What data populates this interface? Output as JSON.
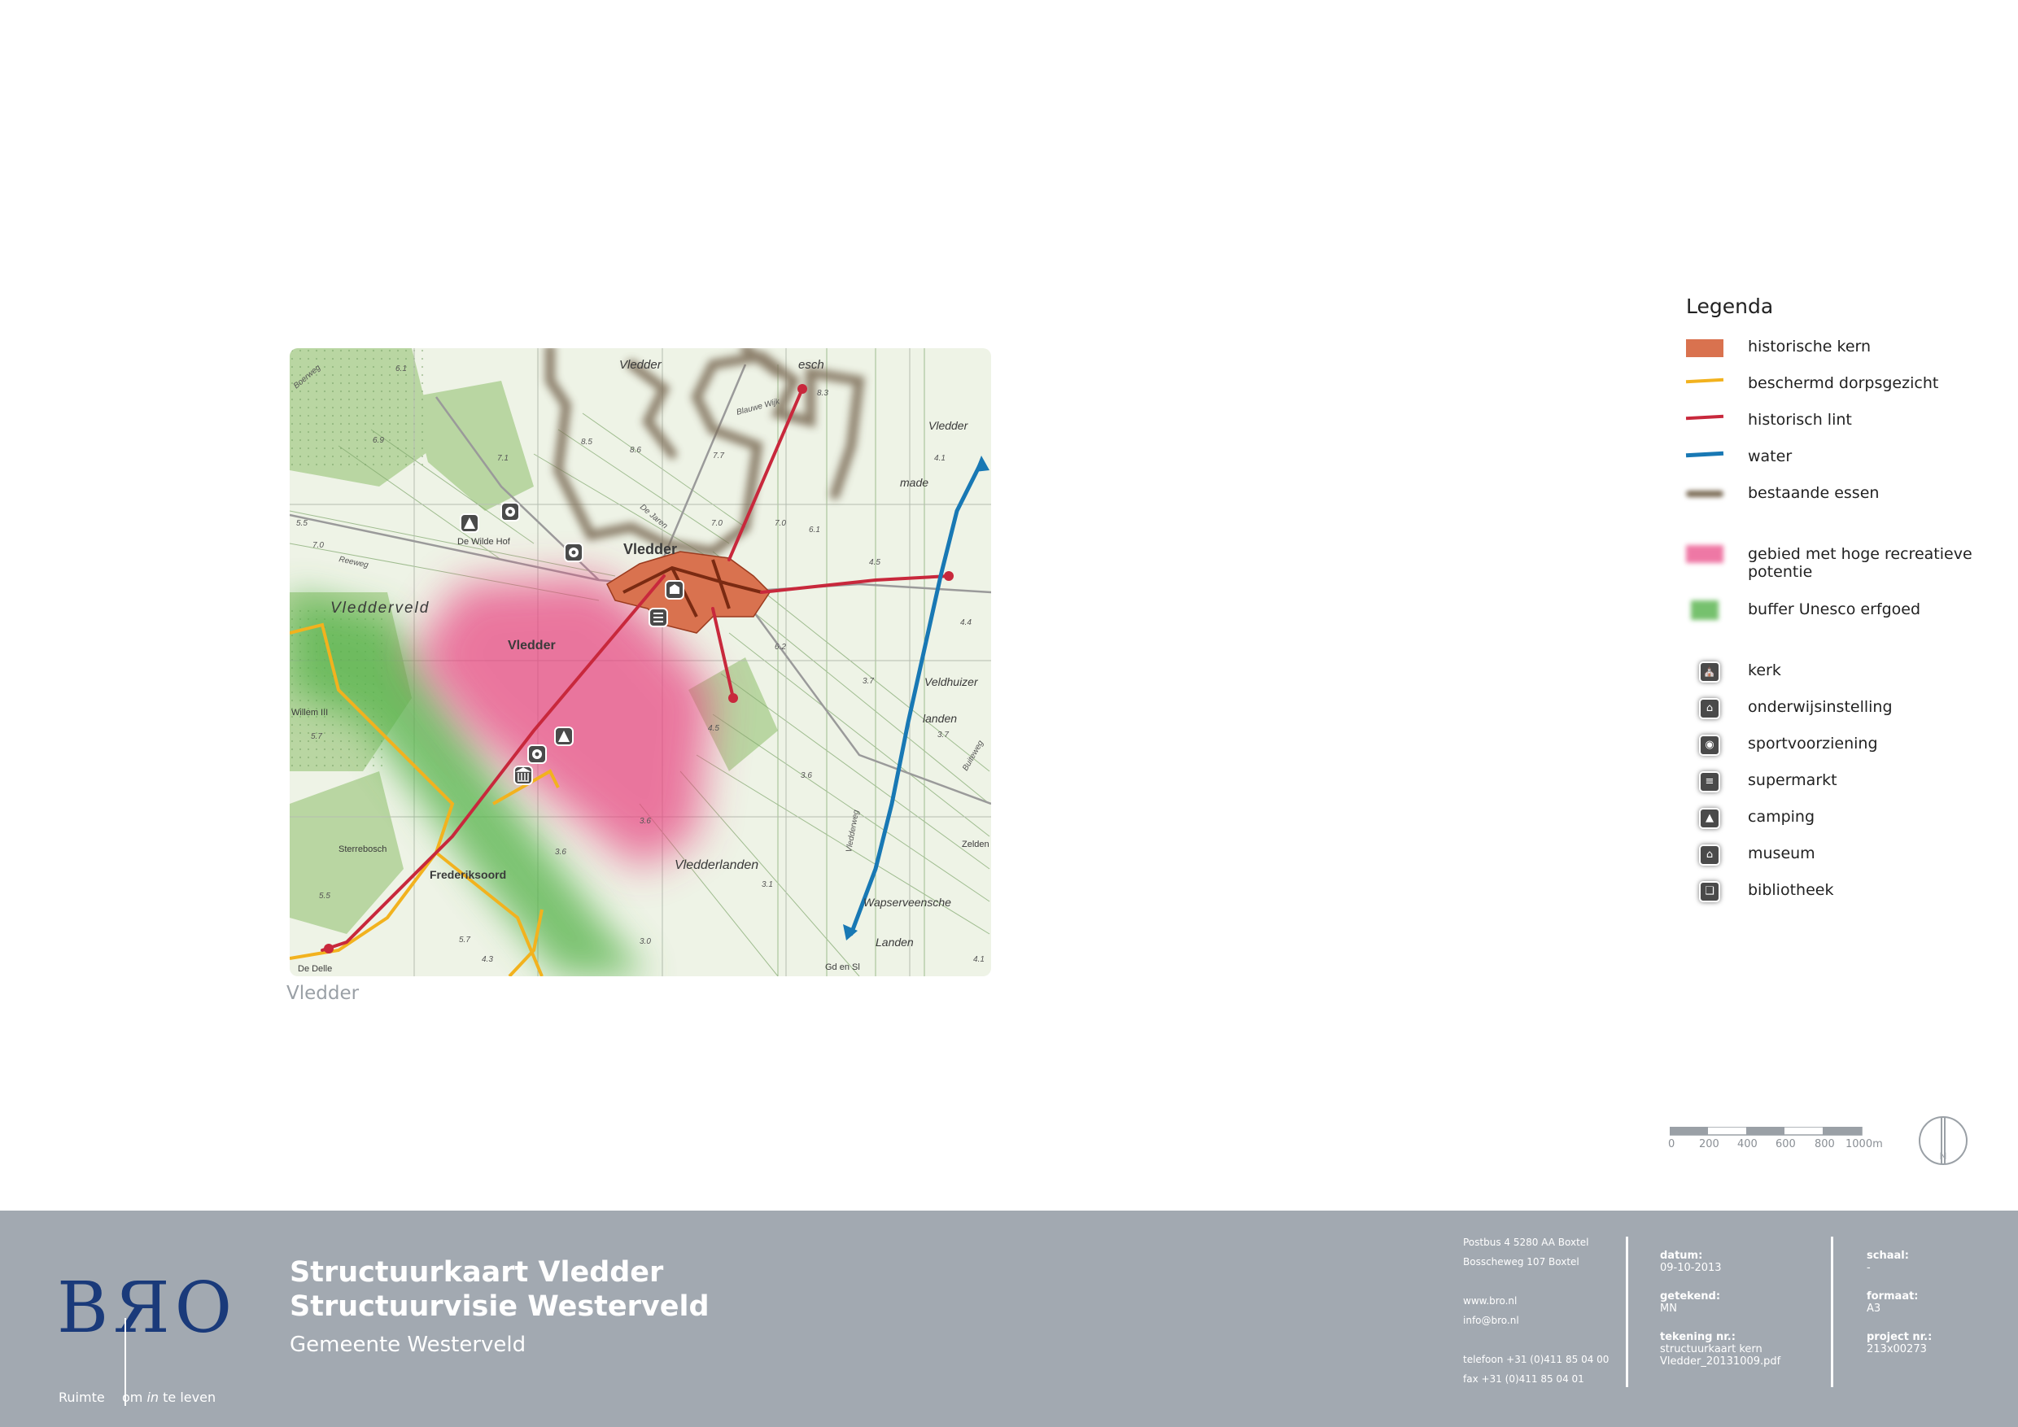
{
  "map": {
    "caption": "Vledder",
    "place_names": [
      "Vledder",
      "Vledder",
      "esch",
      "Vledder",
      "made",
      "Vledderveld",
      "Vledder",
      "Veldhuizer",
      "landen",
      "Vledderlanden",
      "Wapserveensche",
      "Landen",
      "Frederiksoord",
      "De Wilde Hof",
      "Willem III",
      "Sterrebosch",
      "Zelden",
      "Gd en Sl",
      "De Delle"
    ],
    "heights": [
      "6.1",
      "5.5",
      "7.0",
      "6.9",
      "8.5",
      "8.6",
      "7.7",
      "7.1",
      "8.3",
      "7.0",
      "7.0",
      "6.1",
      "4.1",
      "4.5",
      "4.4",
      "6.2",
      "3.7",
      "3.7",
      "3.6",
      "3.6",
      "3.6",
      "3.1",
      "3.0",
      "4.3",
      "5.7",
      "5.7",
      "5.5",
      "4.5",
      "4.1"
    ],
    "road_names": [
      "Reeweg",
      "De Jaren",
      "Blauwe Wijk",
      "Boerweg",
      "Buiteweg",
      "Vledderweg"
    ]
  },
  "legend": {
    "title": "Legenda",
    "items": [
      {
        "label": "historische kern",
        "color": "#d9724f",
        "kind": "fill"
      },
      {
        "label": "beschermd dorpsgezicht",
        "color": "#f2b21e",
        "kind": "line"
      },
      {
        "label": "historisch lint",
        "color": "#c8283c",
        "kind": "line"
      },
      {
        "label": "water",
        "color": "#1878b4",
        "kind": "line"
      },
      {
        "label": "bestaande essen",
        "color": "#7a6a54",
        "kind": "blur"
      }
    ],
    "areas": [
      {
        "label": "gebied met hoge recreatieve potentie",
        "color": "#e8407f"
      },
      {
        "label": "buffer Unesco erfgoed",
        "color": "#55b24a"
      }
    ],
    "icons": [
      {
        "label": "kerk",
        "icon": "church-icon",
        "glyph": "⛪"
      },
      {
        "label": "onderwijsinstelling",
        "icon": "school-icon",
        "glyph": "⌂"
      },
      {
        "label": "sportvoorziening",
        "icon": "sport-icon",
        "glyph": "◉"
      },
      {
        "label": "supermarkt",
        "icon": "supermarket-icon",
        "glyph": "≡"
      },
      {
        "label": "camping",
        "icon": "camping-icon",
        "glyph": "▲"
      },
      {
        "label": "museum",
        "icon": "museum-icon",
        "glyph": "⌂"
      },
      {
        "label": "bibliotheek",
        "icon": "library-icon",
        "glyph": "❑"
      }
    ]
  },
  "scalebar": {
    "labels": [
      "0",
      "200",
      "400",
      "600",
      "800",
      "1000m"
    ]
  },
  "north": "N",
  "footer": {
    "logo": {
      "letters": "BЯO",
      "left": "Ruimte",
      "right_pre": "om ",
      "right_em": "in",
      "right_post": " te leven"
    },
    "title1": "Structuurkaart Vledder",
    "title2": "Structuurvisie Westerveld",
    "subtitle": "Gemeente Westerveld",
    "address": [
      "Postbus 4 5280 AA Boxtel",
      "Bosscheweg 107 Boxtel",
      "www.bro.nl",
      "info@bro.nl",
      "telefoon +31 (0)411 85 04 00",
      "fax +31 (0)411 85 04 01"
    ],
    "meta": {
      "datum_label": "datum:",
      "datum": "09-10-2013",
      "getekend_label": "getekend:",
      "getekend": "MN",
      "tekening_label": "tekening nr.:",
      "tekening": "structuurkaart kern Vledder_20131009.pdf",
      "schaal_label": "schaal:",
      "schaal": "-",
      "formaat_label": "formaat:",
      "formaat": "A3",
      "project_label": "project nr.:",
      "project": "213x00273"
    }
  }
}
